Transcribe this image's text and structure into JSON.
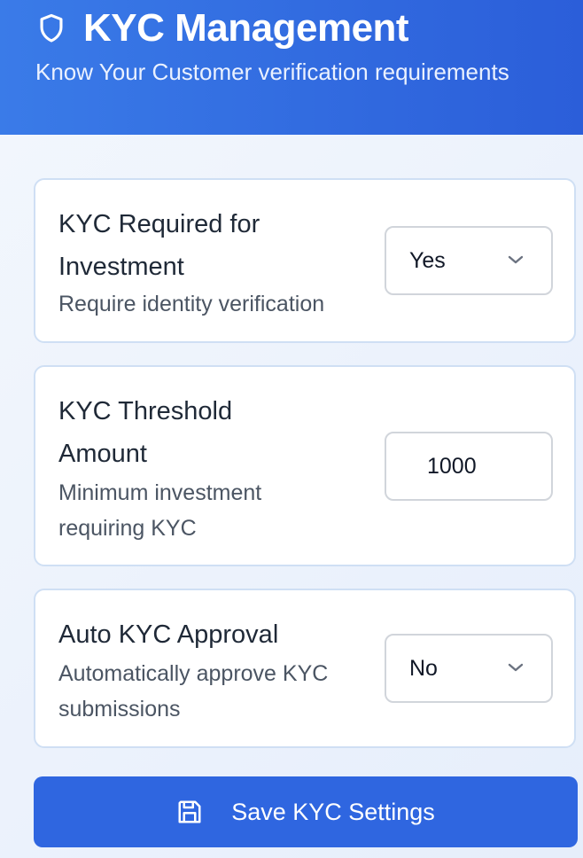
{
  "header": {
    "title": "KYC Management",
    "subtitle": "Know Your Customer verification requirements",
    "icon": "shield-icon"
  },
  "settings": [
    {
      "label_line1": "KYC Required for",
      "label_line2": "Investment",
      "description_line1": "Require identity verification",
      "control": "select",
      "value": "Yes"
    },
    {
      "label_line1": "KYC Threshold",
      "label_line2": "Amount",
      "description_line1": "Minimum investment",
      "description_line2": "requiring KYC",
      "control": "number",
      "currency": "$",
      "value": "1000"
    },
    {
      "label_line1": "Auto KYC Approval",
      "description_line1": "Automatically approve KYC",
      "description_line2": "submissions",
      "control": "select",
      "value": "No"
    }
  ],
  "save_button": {
    "label": "Save KYC Settings",
    "icon": "save-icon"
  },
  "colors": {
    "header_start": "#3a7be8",
    "header_end": "#2b5ed9",
    "button": "#2f66e0",
    "card_border": "#cfdff4"
  }
}
